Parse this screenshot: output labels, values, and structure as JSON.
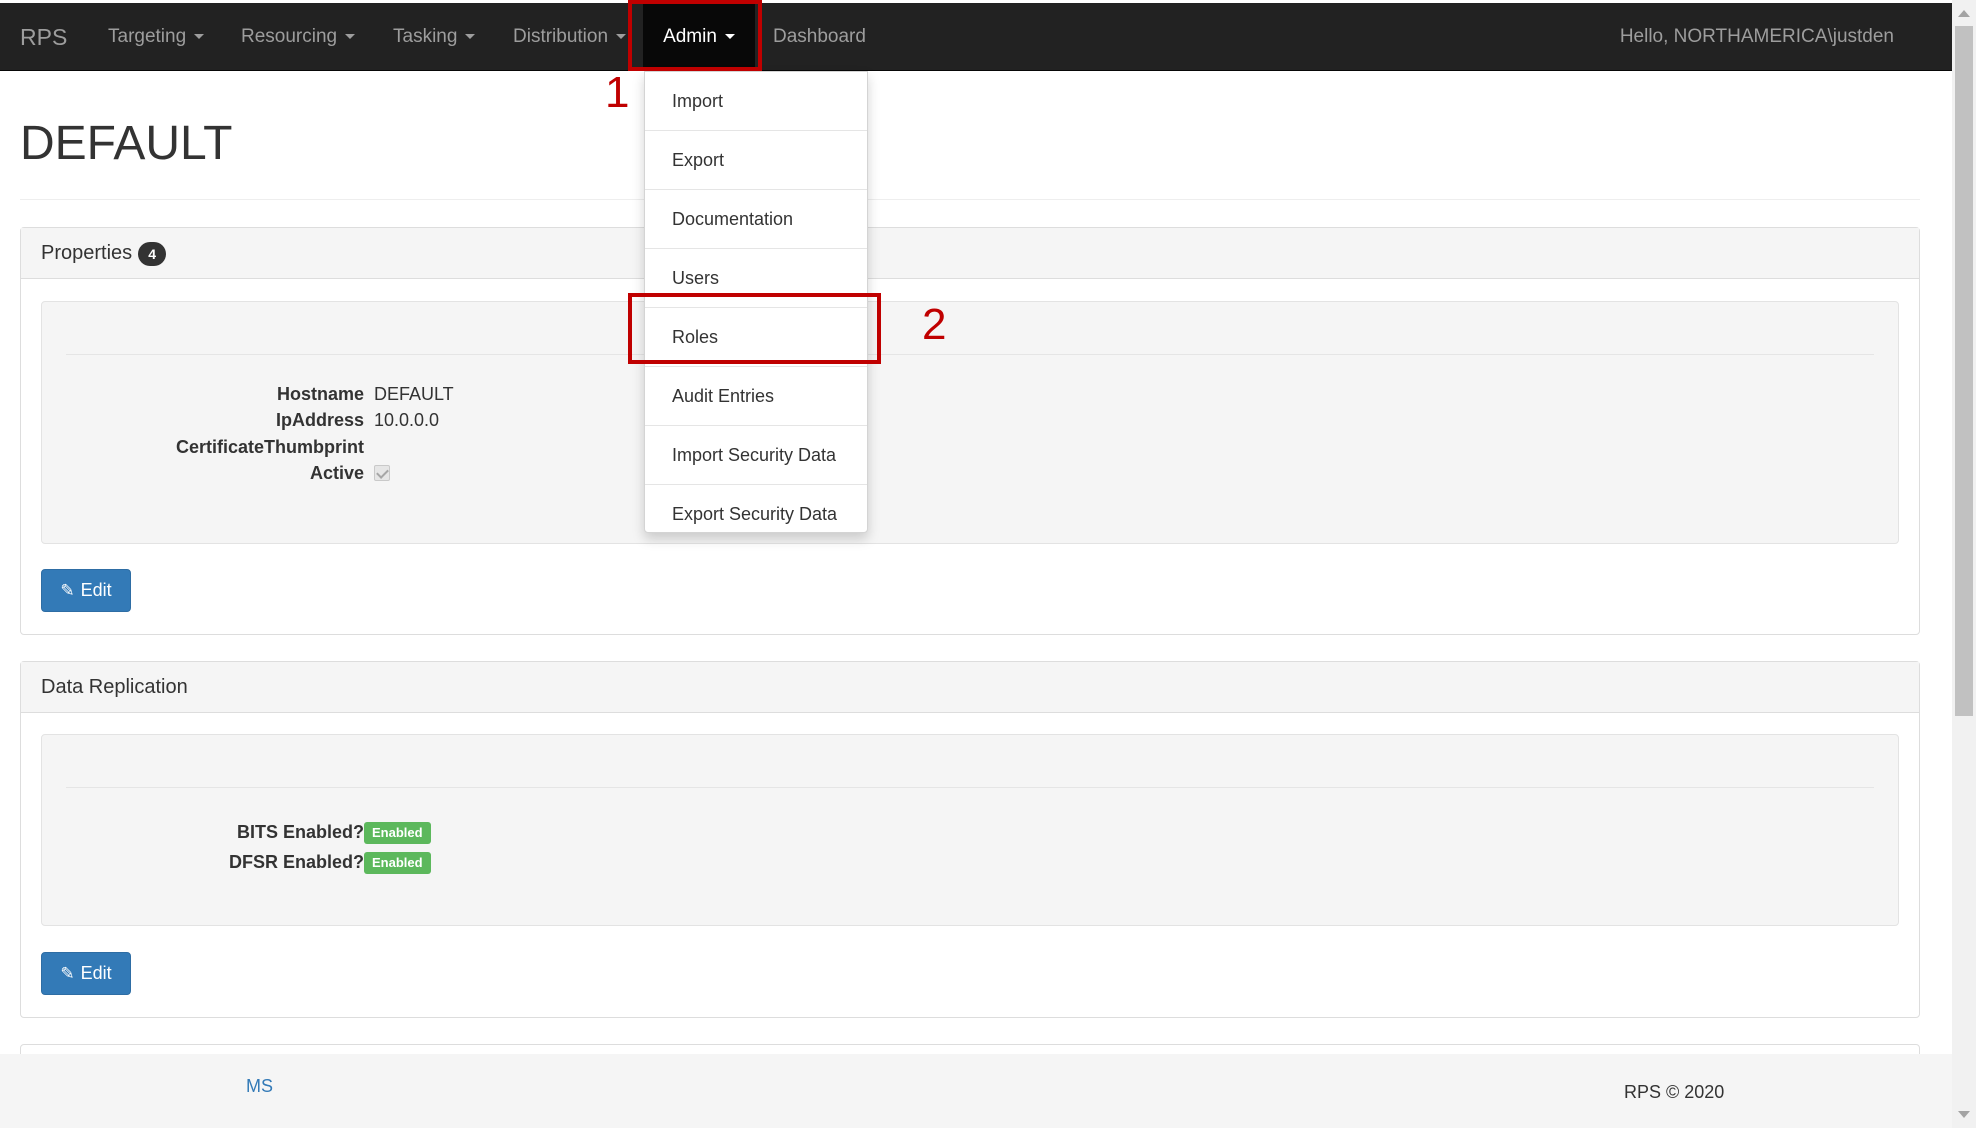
{
  "navbar": {
    "brand": "RPS",
    "items": [
      {
        "label": "Targeting"
      },
      {
        "label": "Resourcing"
      },
      {
        "label": "Tasking"
      },
      {
        "label": "Distribution"
      },
      {
        "label": "Admin"
      },
      {
        "label": "Dashboard"
      }
    ],
    "user_greeting": "Hello, NORTHAMERICA\\justden"
  },
  "admin_menu": {
    "items": [
      {
        "label": "Import"
      },
      {
        "label": "Export"
      },
      {
        "label": "Documentation"
      },
      {
        "label": "Users"
      },
      {
        "label": "Roles"
      },
      {
        "label": "Audit Entries"
      },
      {
        "label": "Import Security Data"
      },
      {
        "label": "Export Security Data"
      }
    ]
  },
  "page": {
    "title": "DEFAULT"
  },
  "properties_panel": {
    "heading": "Properties",
    "badge": "4",
    "fields": [
      {
        "label": "Hostname",
        "value": "DEFAULT"
      },
      {
        "label": "IpAddress",
        "value": "10.0.0.0"
      },
      {
        "label": "CertificateThumbprint",
        "value": ""
      },
      {
        "label": "Active",
        "checked": true
      }
    ],
    "edit_label": "Edit"
  },
  "replication_panel": {
    "heading": "Data Replication",
    "fields": [
      {
        "label": "BITS Enabled?",
        "status": "Enabled"
      },
      {
        "label": "DFSR Enabled?",
        "status": "Enabled"
      }
    ],
    "edit_label": "Edit"
  },
  "annotations": {
    "step1": "1",
    "step2": "2",
    "color": "#c00000"
  },
  "footer": {
    "link": "MS",
    "copyright": "RPS © 2020"
  },
  "colors": {
    "navbar_bg": "#222222",
    "primary_button": "#337ab7",
    "success_label": "#5cb85c"
  }
}
